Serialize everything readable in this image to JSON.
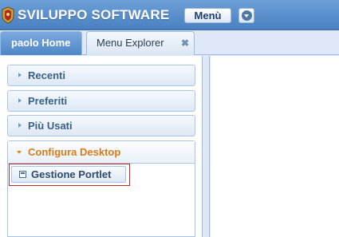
{
  "header": {
    "app_title": "SVILUPPO SOFTWARE",
    "menu_label": "Menù",
    "menu_dropdown_icon": "chevron-down-icon",
    "logo_icon": "crest-icon",
    "colors": {
      "bar": "#4a80c2",
      "title": "#ffffff"
    }
  },
  "tabs": [
    {
      "label": "paolo Home",
      "active": true
    },
    {
      "label": "Menu Explorer",
      "active": false,
      "close": "✖"
    }
  ],
  "sidebar": {
    "items": [
      {
        "label": "Recenti",
        "expanded": false
      },
      {
        "label": "Preferiti",
        "expanded": false
      },
      {
        "label": "Più Usati",
        "expanded": false
      },
      {
        "label": "Configura Desktop",
        "expanded": true
      }
    ],
    "configura_items": [
      {
        "label": "Gestione Portlet",
        "icon": "portlet-icon"
      }
    ],
    "colors": {
      "expanded_label": "#d97c16",
      "label": "#3b5f86",
      "highlight": "#c0262c"
    }
  }
}
